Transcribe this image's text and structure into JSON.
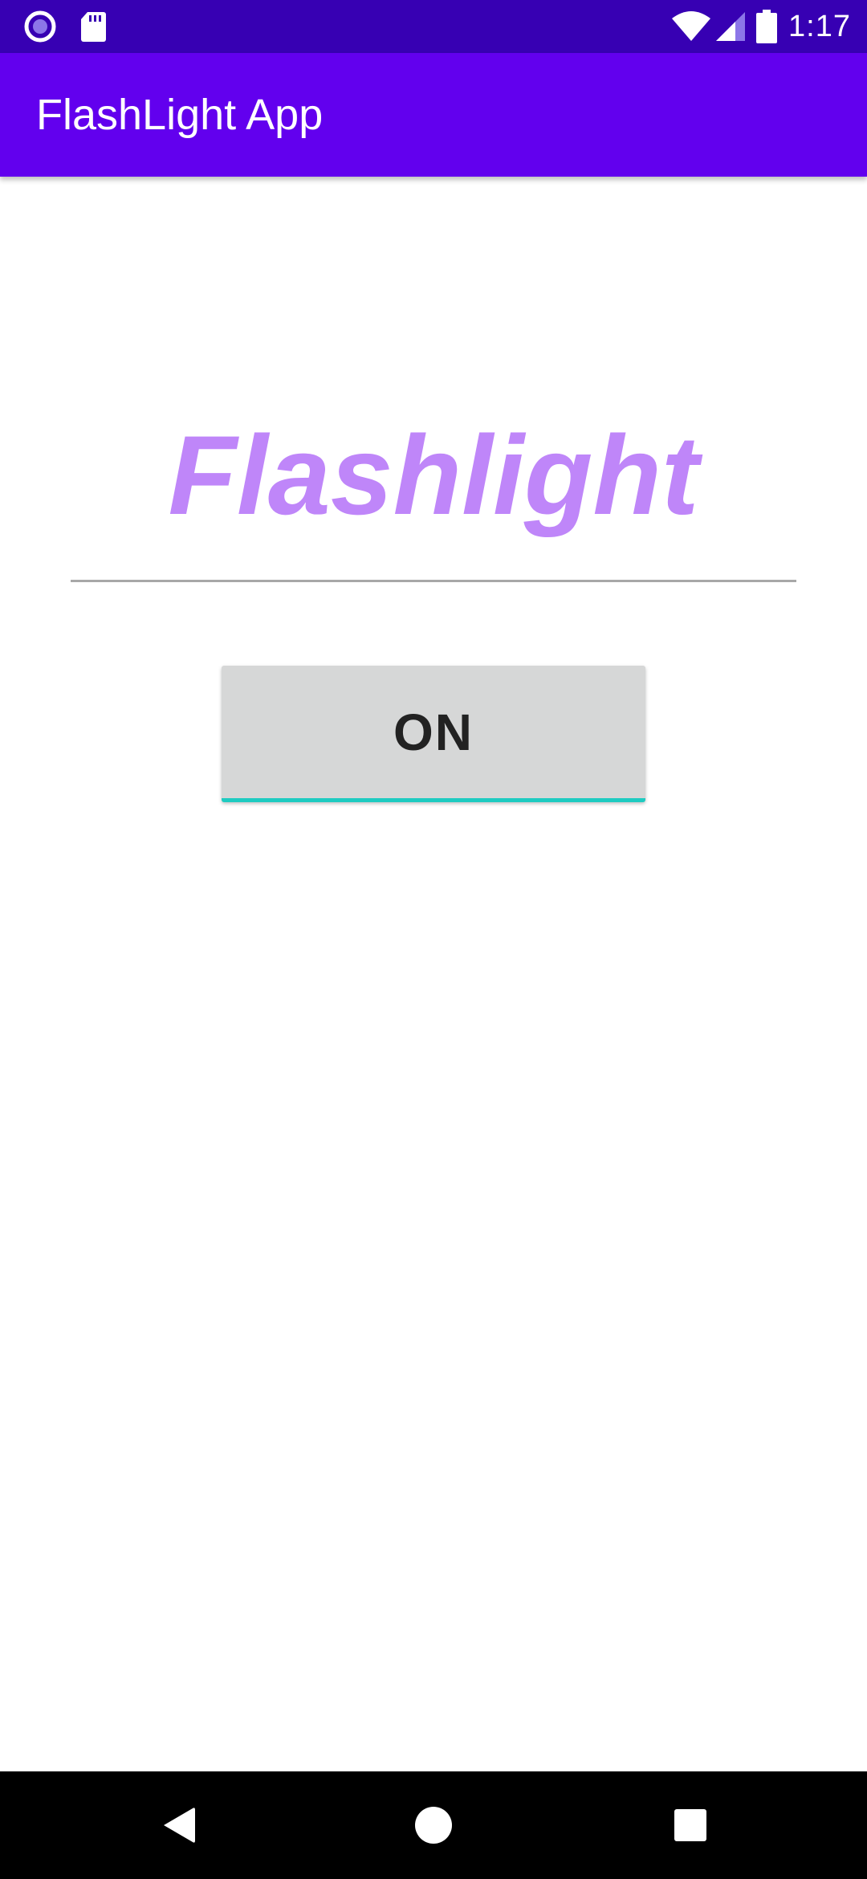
{
  "status_bar": {
    "time": "1:17",
    "left_icons": [
      "radio-button-notification-icon",
      "sd-card-icon"
    ],
    "right_icons": [
      "wifi-icon",
      "cellular-signal-icon",
      "battery-icon"
    ],
    "background": "#3700b3"
  },
  "app_bar": {
    "title": "FlashLight App",
    "background": "#6200ee"
  },
  "main": {
    "headline": "Flashlight",
    "headline_color": "#bf86f9",
    "toggle_button_label": "ON",
    "button_accent": "#1ecbc1"
  },
  "nav_bar": {
    "buttons": [
      "back-icon",
      "home-icon",
      "recents-icon"
    ]
  }
}
